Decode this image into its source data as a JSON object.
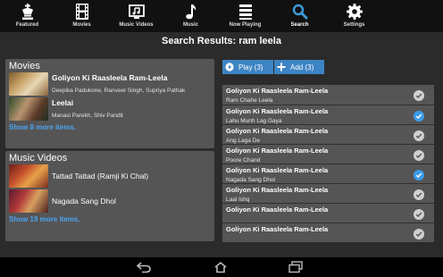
{
  "nav": {
    "items": [
      {
        "label": "Featured",
        "icon": "chess-king-icon"
      },
      {
        "label": "Movies",
        "icon": "film-strip-icon"
      },
      {
        "label": "Music Videos",
        "icon": "music-video-icon"
      },
      {
        "label": "Music",
        "icon": "music-note-icon"
      },
      {
        "label": "Now Playing",
        "icon": "playlist-icon"
      },
      {
        "label": "Search",
        "icon": "search-icon",
        "active": true
      },
      {
        "label": "Settings",
        "icon": "gear-icon"
      }
    ]
  },
  "page_title": "Search Results: ram leela",
  "movies": {
    "heading": "Movies",
    "items": [
      {
        "title": "Goliyon Ki Raasleela Ram-Leela",
        "subtitle": "Deepika Padukone, Ranveer Singh, Supriya Pathak"
      },
      {
        "title": "Leelai",
        "subtitle": "Manasi Parekh, Shiv Pandit"
      }
    ],
    "show_more": "Show 8 more items."
  },
  "music_videos": {
    "heading": "Music Videos",
    "items": [
      {
        "title": "Tattad Tattad (Ramji Ki Chal)"
      },
      {
        "title": "Nagada Sang Dhol"
      }
    ],
    "show_more": "Show 19 more items."
  },
  "actions": {
    "play_label": "Play (3)",
    "add_label": "Add (3)"
  },
  "songs": [
    {
      "title": "Goliyon Ki Raasleela Ram-Leela",
      "artist": "Ram Chahe Leela",
      "selected": false
    },
    {
      "title": "Goliyon Ki Raasleela Ram-Leela",
      "artist": "Lahu Munh Lag Gaya",
      "selected": true
    },
    {
      "title": "Goliyon Ki Raasleela Ram-Leela",
      "artist": "Ang Laga De",
      "selected": false
    },
    {
      "title": "Goliyon Ki Raasleela Ram-Leela",
      "artist": "Poore Chand",
      "selected": false
    },
    {
      "title": "Goliyon Ki Raasleela Ram-Leela",
      "artist": "Nagada Sang Dhol",
      "selected": true
    },
    {
      "title": "Goliyon Ki Raasleela Ram-Leela",
      "artist": "Laal Ishq",
      "selected": false
    },
    {
      "title": "Goliyon Ki Raasleela Ram-Leela",
      "artist": "",
      "selected": false
    },
    {
      "title": "Goliyon Ki Raasleela Ram-Leela",
      "artist": "",
      "selected": false
    }
  ],
  "colors": {
    "accent": "#3d84c4",
    "link": "#4aa3f0",
    "check_selected": "#3d9be9",
    "check_unselected": "#d0d0d0"
  }
}
